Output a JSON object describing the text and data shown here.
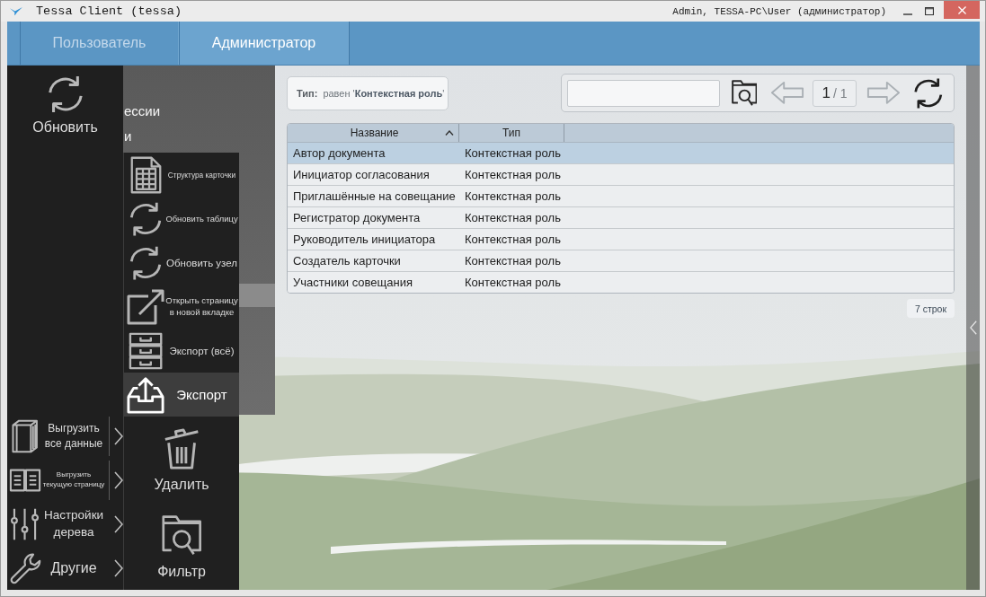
{
  "window": {
    "title": "Tessa Client (tessa)",
    "user": "Admin, TESSA-PC\\User (администратор)"
  },
  "tabs": [
    {
      "label": "Пользователь",
      "selected": false
    },
    {
      "label": "Администратор",
      "selected": true
    }
  ],
  "tree": {
    "items": [
      {
        "label": "ессии",
        "selected": false
      },
      {
        "label": "и",
        "selected": false
      }
    ]
  },
  "menu": {
    "main": {
      "label": "Обновить"
    },
    "submenus": [
      {
        "label": "Выгрузить все данные",
        "kind": "unload",
        "split": true
      },
      {
        "label": "Выгрузить текущую страницу",
        "kind": "page",
        "split": true
      },
      {
        "label": "Настройки дерева",
        "kind": "settings",
        "split": false
      },
      {
        "label": "Другие",
        "kind": "other",
        "split": false
      }
    ],
    "actions": [
      {
        "label": "Структура карточки",
        "kind": "structure",
        "selected": false
      },
      {
        "label": "Обновить таблицу",
        "kind": "refresh",
        "selected": false
      },
      {
        "label": "Обновить узел",
        "kind": "refresh",
        "selected": false
      },
      {
        "label": "Открыть страницу в новой вкладке",
        "kind": "open",
        "selected": false
      },
      {
        "label": "Экспорт (всё)",
        "kind": "archive",
        "selected": false
      },
      {
        "label": "Экспорт",
        "kind": "export",
        "selected": true
      }
    ],
    "tiles": [
      {
        "label": "Удалить",
        "kind": "delete"
      },
      {
        "label": "Фильтр",
        "kind": "filter"
      }
    ]
  },
  "filter_chip": {
    "field": "Тип:",
    "condition": "равен '**Контекстная роль**'"
  },
  "pager": {
    "current": "1",
    "total": "/ 1",
    "back_disabled": true,
    "forward_disabled": true
  },
  "table": {
    "columns": [
      {
        "label": "Название",
        "sorted": true
      },
      {
        "label": "Тип",
        "sorted": false
      }
    ],
    "rows": [
      {
        "cells": [
          "Автор документа",
          "Контекстная роль"
        ],
        "selected": true
      },
      {
        "cells": [
          "Инициатор согласования",
          "Контекстная роль"
        ],
        "selected": false
      },
      {
        "cells": [
          "Приглашённые на совещание",
          "Контекстная роль"
        ],
        "selected": false
      },
      {
        "cells": [
          "Регистратор документа",
          "Контекстная роль"
        ],
        "selected": false
      },
      {
        "cells": [
          "Руководитель инициатора",
          "Контекстная роль"
        ],
        "selected": false
      },
      {
        "cells": [
          "Создатель карточки",
          "Контекстная роль"
        ],
        "selected": false
      },
      {
        "cells": [
          "Участники совещания",
          "Контекстная роль"
        ],
        "selected": false
      }
    ]
  },
  "row_count": "7 строк"
}
